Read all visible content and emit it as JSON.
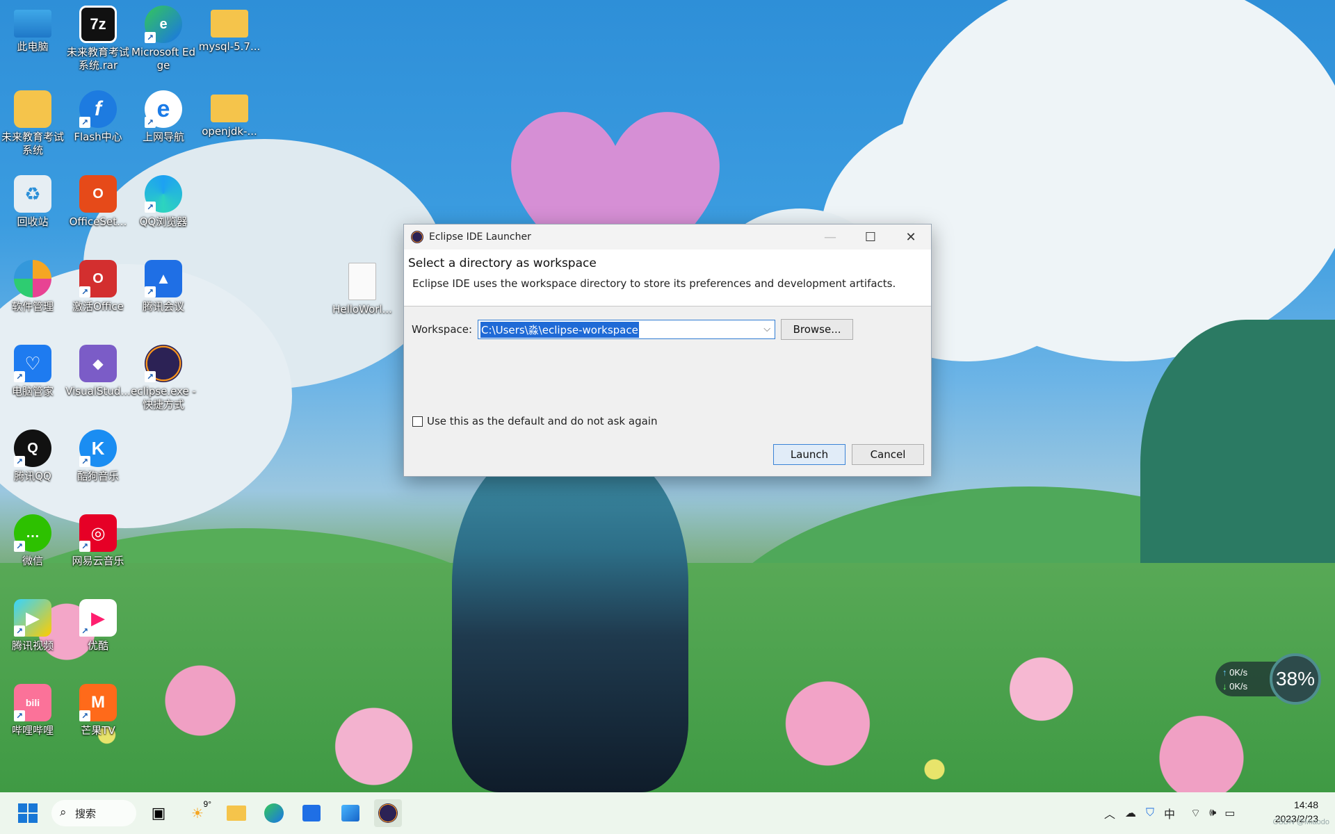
{
  "desktop": {
    "icons": [
      {
        "label": "此电脑"
      },
      {
        "label": "未来教育考试系统.rar"
      },
      {
        "label": "Microsoft Edge"
      },
      {
        "label": "mysql-5.7..."
      },
      {
        "label": "未来教育考试系统"
      },
      {
        "label": "Flash中心"
      },
      {
        "label": "上网导航"
      },
      {
        "label": "openjdk-..."
      },
      {
        "label": "回收站"
      },
      {
        "label": "OfficeSet..."
      },
      {
        "label": "QQ浏览器"
      },
      {
        "label": "软件管理"
      },
      {
        "label": "激活Office"
      },
      {
        "label": "腾讯会议"
      },
      {
        "label": "HelloWorl..."
      },
      {
        "label": "电脑管家"
      },
      {
        "label": "VisualStud..."
      },
      {
        "label": "eclipse.exe - 快捷方式"
      },
      {
        "label": "腾讯QQ"
      },
      {
        "label": "酷狗音乐"
      },
      {
        "label": "微信"
      },
      {
        "label": "网易云音乐"
      },
      {
        "label": "腾讯视频"
      },
      {
        "label": "优酷"
      },
      {
        "label": "哔哩哔哩"
      },
      {
        "label": "芒果TV"
      }
    ]
  },
  "dialog": {
    "title": "Eclipse IDE Launcher",
    "heading": "Select a directory as workspace",
    "description": "Eclipse IDE uses the workspace directory to store its preferences and development artifacts.",
    "workspace_label": "Workspace:",
    "workspace_value": "C:\\Users\\淼\\eclipse-workspace",
    "browse_label": "Browse...",
    "default_checkbox_label": "Use this as the default and do not ask again",
    "launch_label": "Launch",
    "cancel_label": "Cancel"
  },
  "net_widget": {
    "upload": "0K/s",
    "download": "0K/s",
    "percent": "38%"
  },
  "taskbar": {
    "search_label": "搜索",
    "weather_temp": "9°",
    "ime_label": "中",
    "time": "14:48",
    "date": "2023/2/23"
  },
  "watermark": "CSDN @Miaodo",
  "colors": {
    "accent": "#1f6ad6",
    "sky": "#2e8fd8",
    "grass": "#3f9a44"
  }
}
